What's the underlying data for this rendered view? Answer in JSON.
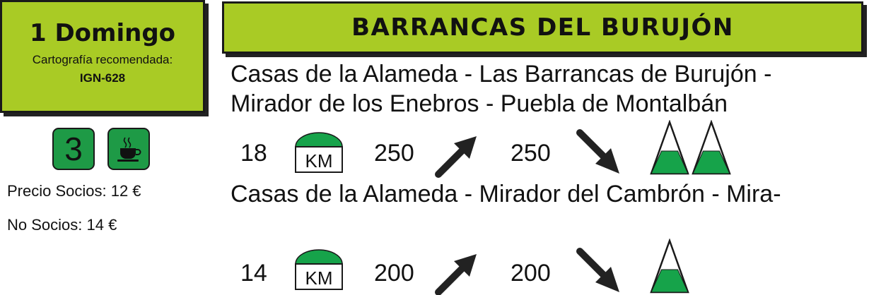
{
  "header": {
    "date": "1 Domingo",
    "cartography_label": "Cartografía recomendada:",
    "cartography_map": "IGN-628"
  },
  "title": "BARRANCAS DEL BURUJÓN",
  "badges": {
    "difficulty": "3",
    "icon": "coffee-cup-icon"
  },
  "prices": {
    "members": "Precio Socios: 12 €",
    "non_members": "No Socios: 14 €"
  },
  "route_long": {
    "lines": [
      "Casas de la Alameda - Las Barrancas de Burujón -",
      "Mirador de los Enebros - Puebla de Montalbán"
    ],
    "distance": "18",
    "distance_unit": "KM",
    "ascent": "250",
    "descent": "250",
    "difficulty_mountains": 2
  },
  "route_short": {
    "lines": [
      "Casas de la Alameda - Mirador del Cambrón - Mira-"
    ],
    "distance": "14",
    "distance_unit": "KM",
    "ascent": "200",
    "descent": "200",
    "difficulty_mountains": 1
  },
  "colors": {
    "accent_green": "#a9cb25",
    "badge_green": "#1e9a46",
    "mountain_green": "#16a34a",
    "arrow": "#222222"
  }
}
